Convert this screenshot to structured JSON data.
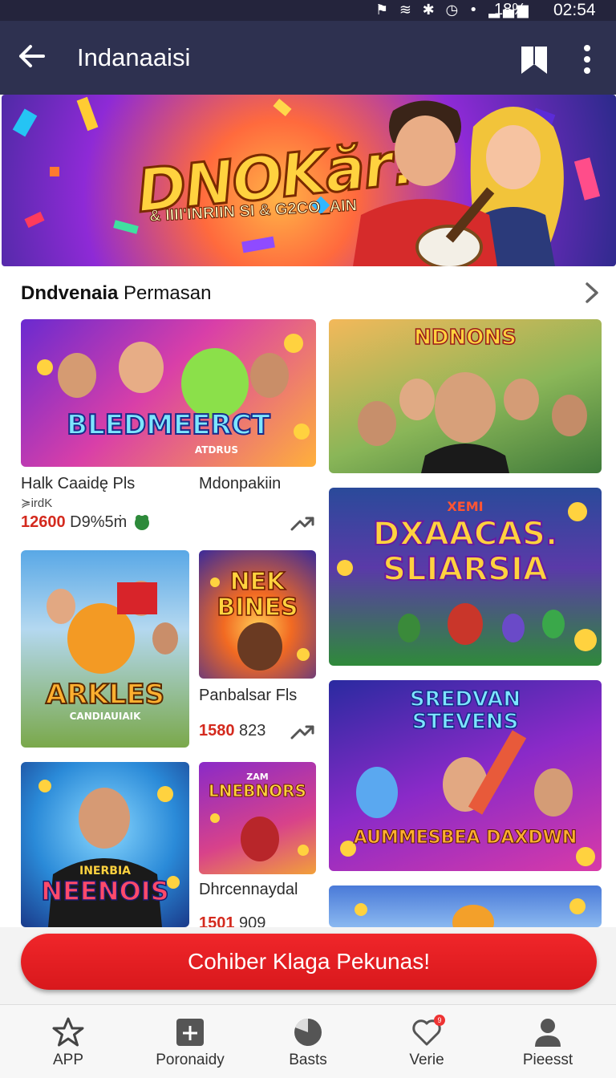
{
  "status_bar": {
    "battery": "18%",
    "time": "02:54"
  },
  "app_bar": {
    "title": "Indanaaisi"
  },
  "banner": {
    "logo": "DNOKăr!",
    "tagline": "& IIII'INRIIN SI & G2CO_AIN"
  },
  "section": {
    "title_bold": "Dndvenaia",
    "title_rest": " Permasan"
  },
  "cards": [
    {
      "logo": "BLEDMEERCT",
      "logo_sub": "ATDRUS",
      "title": "Halk Caaidę Pls",
      "sub": "≽irdK",
      "stat_num": "12600",
      "stat_rest": " D9%5ṁ"
    },
    {
      "logo": "NDNONS",
      "logo_sub": "",
      "title": "Mdonpakiin"
    },
    {
      "logo": "DXAACAS. SLIARSIA",
      "logo_sub": "XEMI"
    },
    {
      "logo": "ARKLES",
      "logo_sub": "CANDIAUIAIK"
    },
    {
      "logo": "NEK BINES",
      "title": "Panbalsar Fls",
      "stat_num": "1580",
      "stat_rest": " 823"
    },
    {
      "logo": "SREDVAN STEVENS",
      "logo_sub": "AUMMESBEA DAXDWN"
    },
    {
      "logo": "NEENOIS",
      "logo_sub": "INERBIA"
    },
    {
      "logo": "LNEBNORS",
      "logo_sub": "ZAM",
      "title": "Dhrcennaydal",
      "stat_num": "1501",
      "stat_rest": " 909"
    }
  ],
  "cta": {
    "label": "Cohiber Klaga Pekunas!"
  },
  "bottom_nav": [
    {
      "label": "APP",
      "icon": "star-icon"
    },
    {
      "label": "Poronaidy",
      "icon": "grid-add-icon"
    },
    {
      "label": "Basts",
      "icon": "pie-icon"
    },
    {
      "label": "Verie",
      "icon": "heart-icon",
      "badge": "9"
    },
    {
      "label": "Pieesst",
      "icon": "person-icon"
    }
  ],
  "colors": {
    "app_bar": "#2e3150",
    "accent_red": "#d8181c",
    "stat_red": "#d42a1e"
  }
}
